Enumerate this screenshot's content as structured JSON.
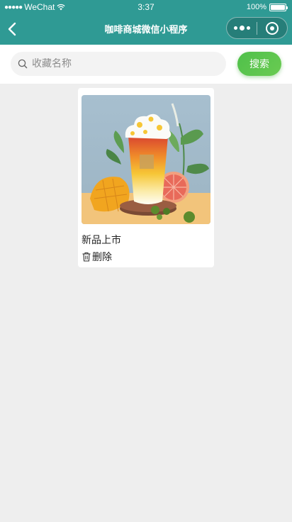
{
  "status_bar": {
    "carrier": "WeChat",
    "time": "3:37",
    "battery": "100%"
  },
  "nav": {
    "title": "咖啡商城微信小程序"
  },
  "search": {
    "placeholder": "收藏名称",
    "value": "",
    "button_label": "搜索"
  },
  "favorites": [
    {
      "title": "新品上市",
      "delete_label": "删除",
      "image": "mango-grapefruit-drink"
    }
  ],
  "colors": {
    "header": "#2f9a94",
    "accent": "#52c14b",
    "background": "#eeeeee"
  },
  "icons": [
    "signal-dots-icon",
    "wifi-icon",
    "battery-icon",
    "back-chevron-icon",
    "more-dots-icon",
    "close-target-icon",
    "search-icon",
    "trash-icon"
  ]
}
